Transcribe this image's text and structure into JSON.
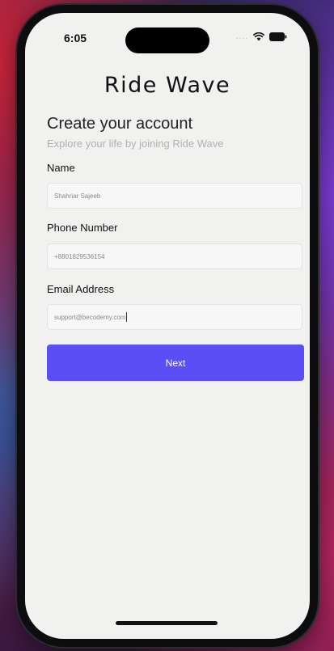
{
  "status_bar": {
    "time": "6:05",
    "signal": "....",
    "wifi_icon": "wifi-icon",
    "battery_icon": "battery-icon"
  },
  "app": {
    "title": "Ride Wave"
  },
  "form": {
    "heading": "Create your account",
    "subheading": "Explore your life by joining Ride Wave",
    "name_label": "Name",
    "name_value": "Shahriar Sajeeb",
    "phone_label": "Phone Number",
    "phone_value": "+8801829536154",
    "email_label": "Email Address",
    "email_value": "support@becodemy.com",
    "next_label": "Next"
  },
  "colors": {
    "accent": "#5b4ef5",
    "screen_background": "#f1f1f0"
  }
}
